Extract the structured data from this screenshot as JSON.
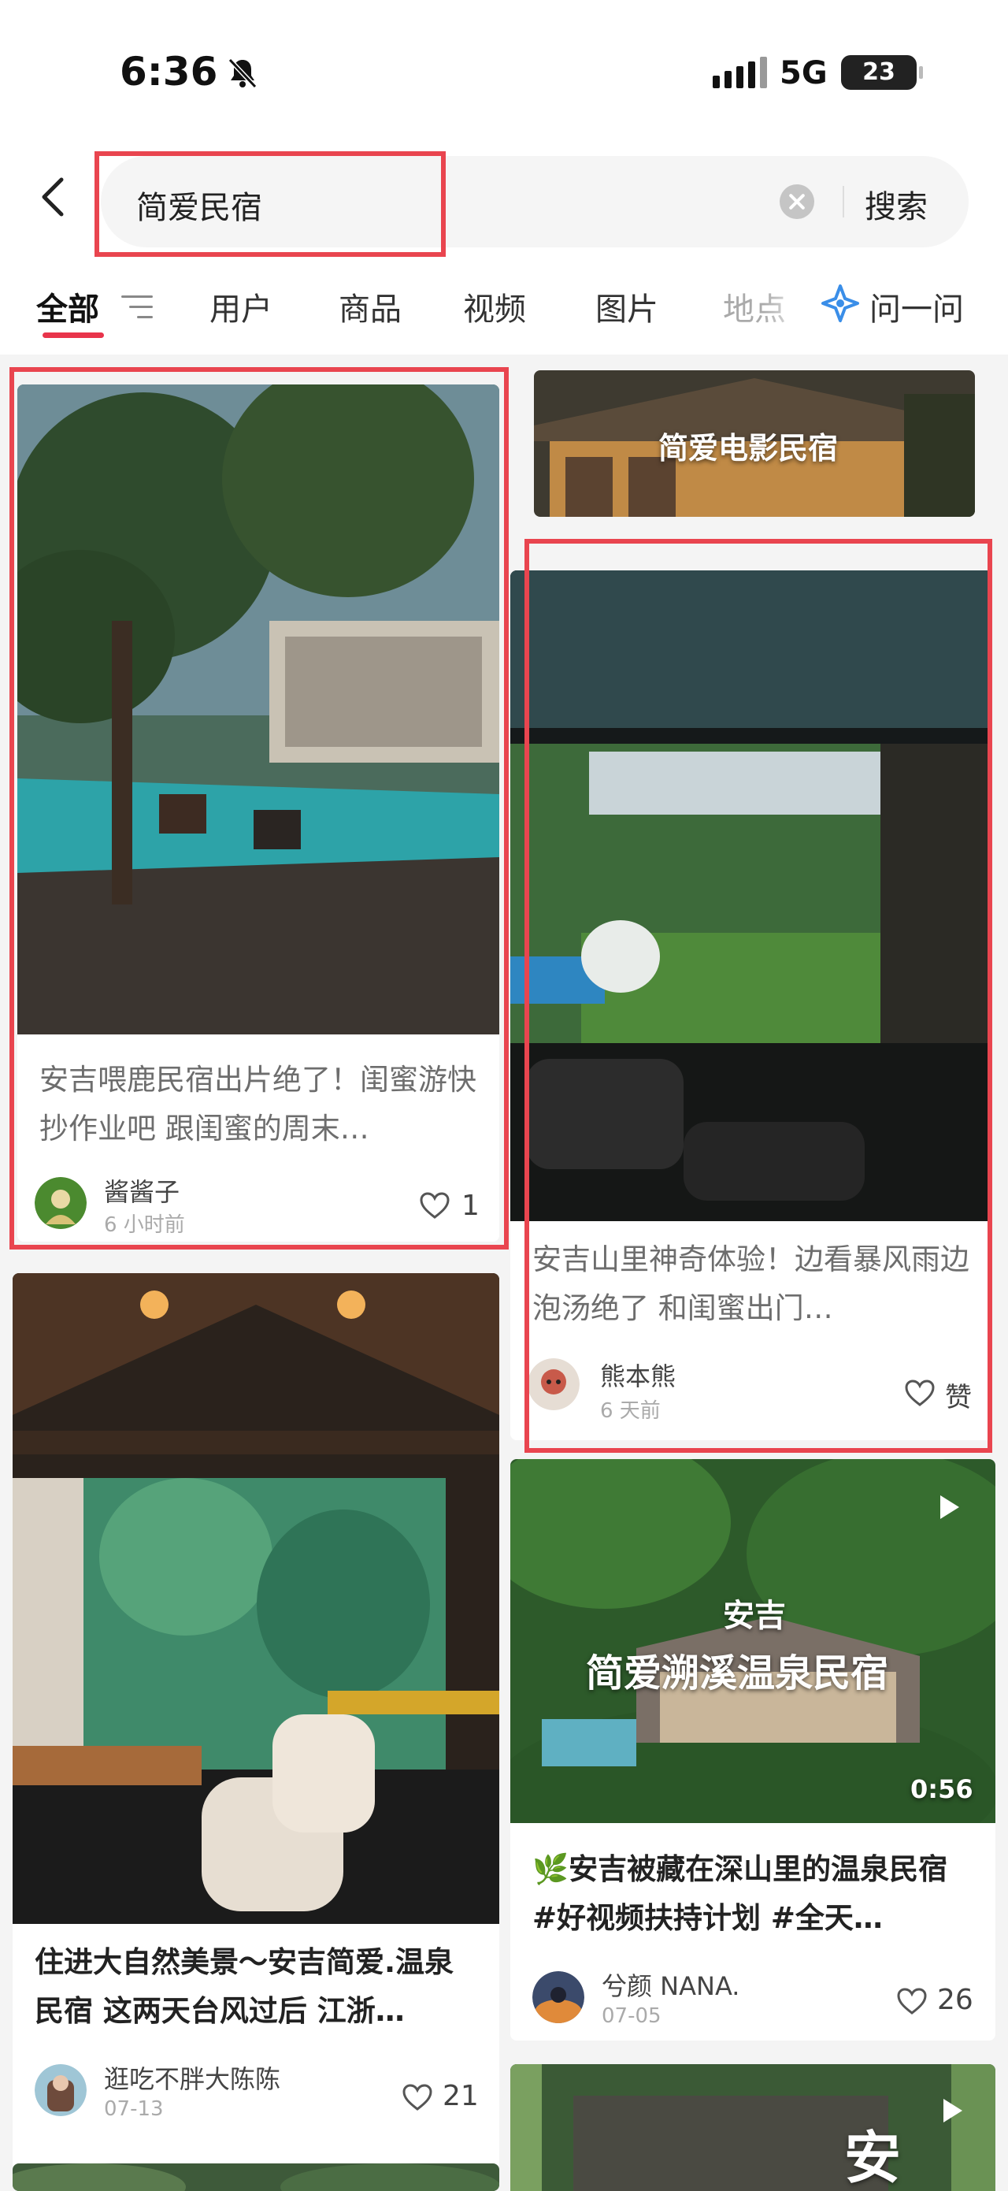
{
  "status": {
    "time": "6:36",
    "network": "5G",
    "battery": "23"
  },
  "search": {
    "query": "简爱民宿",
    "button": "搜索"
  },
  "tabs": [
    {
      "label": "全部",
      "active": true
    },
    {
      "label": "用户"
    },
    {
      "label": "商品"
    },
    {
      "label": "视频"
    },
    {
      "label": "图片"
    },
    {
      "label": "地点"
    }
  ],
  "ask": "问一问",
  "cards": {
    "banner": {
      "overlay": "简爱电影民宿"
    },
    "c1": {
      "title": "安吉喂鹿民宿出片绝了！闺蜜游快抄作业吧 跟闺蜜的周末…",
      "user": "酱酱子",
      "time": "6 小时前",
      "likes": "1"
    },
    "c2": {
      "title": "安吉山里神奇体验！边看暴风雨边泡汤绝了 和闺蜜出门…",
      "user": "熊本熊",
      "time": "6 天前",
      "likes": "赞"
    },
    "c3": {
      "title": "住进大自然美景～安吉简爱.温泉民宿 这两天台风过后 江浙…",
      "user": "逛吃不胖大陈陈",
      "time": "07-13",
      "likes": "21"
    },
    "c4": {
      "overlay_top": "安吉",
      "overlay_main": "简爱溯溪温泉民宿",
      "duration": "0:56",
      "title": "🌿安吉被藏在深山里的温泉民宿 #好视频扶持计划 #全天…",
      "user": "兮颜 NANA.",
      "time": "07-05",
      "likes": "26"
    },
    "c5": {
      "overlay": "安"
    }
  },
  "colors": {
    "accent": "#e8344b",
    "highlight": "#e9454f"
  }
}
